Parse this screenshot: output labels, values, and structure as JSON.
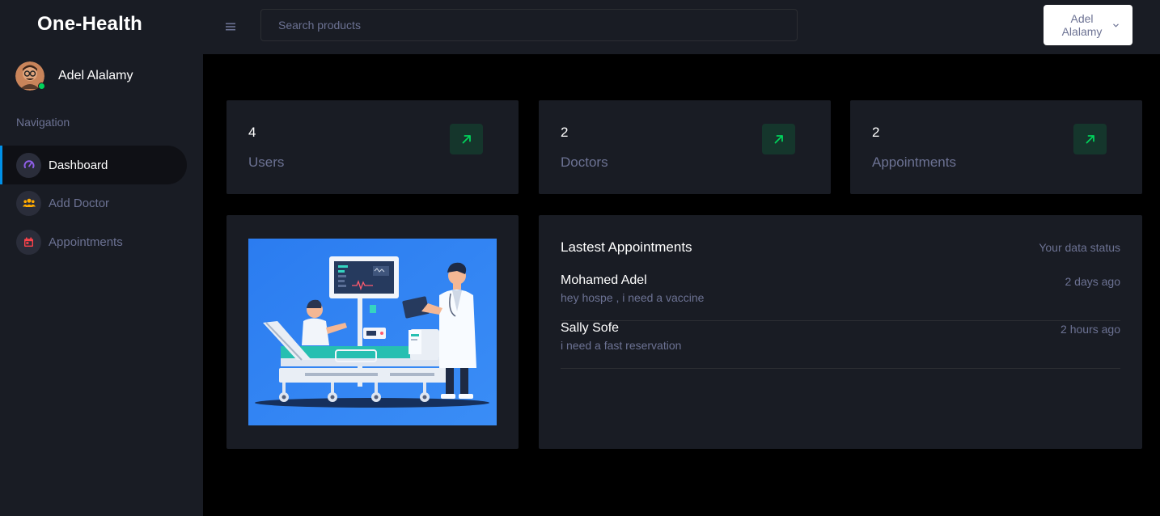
{
  "app": {
    "brand": "One-Health"
  },
  "profile": {
    "name": "Adel Alalamy",
    "status_color": "#00d25b"
  },
  "sidebar": {
    "heading": "Navigation",
    "items": [
      {
        "label": "Dashboard",
        "icon": "speedometer-icon",
        "icon_color": "#8f5fe8",
        "active": true
      },
      {
        "label": "Add Doctor",
        "icon": "users-icon",
        "icon_color": "#ffab00",
        "active": false
      },
      {
        "label": "Appointments",
        "icon": "calendar-icon",
        "icon_color": "#fc424a",
        "active": false
      }
    ]
  },
  "header": {
    "menu_icon": "hamburger-icon",
    "search": {
      "placeholder": "Search products",
      "value": ""
    },
    "user_menu": {
      "label_line1": "Adel",
      "label_line2": "Alalamy",
      "icon": "chevron-down-icon"
    }
  },
  "stats": [
    {
      "value": "4",
      "label": "Users",
      "icon": "arrow-up-right-icon",
      "icon_color": "#00d25b"
    },
    {
      "value": "2",
      "label": "Doctors",
      "icon": "arrow-up-right-icon",
      "icon_color": "#00d25b"
    },
    {
      "value": "2",
      "label": "Appointments",
      "icon": "arrow-up-right-icon",
      "icon_color": "#00d25b"
    }
  ],
  "appointments": {
    "title": "Lastest Appointments",
    "status_label": "Your data status",
    "items": [
      {
        "name": "Mohamed Adel",
        "message": "hey hospe , i need a vaccine",
        "time": "2 days ago"
      },
      {
        "name": "Sally Sofe",
        "message": "i need a fast reservation",
        "time": "2 hours ago"
      }
    ]
  },
  "colors": {
    "sidebar_bg": "#191c24",
    "content_bg": "#000000",
    "muted_text": "#6c7293",
    "accent": "#0090e7",
    "success": "#00d25b"
  }
}
